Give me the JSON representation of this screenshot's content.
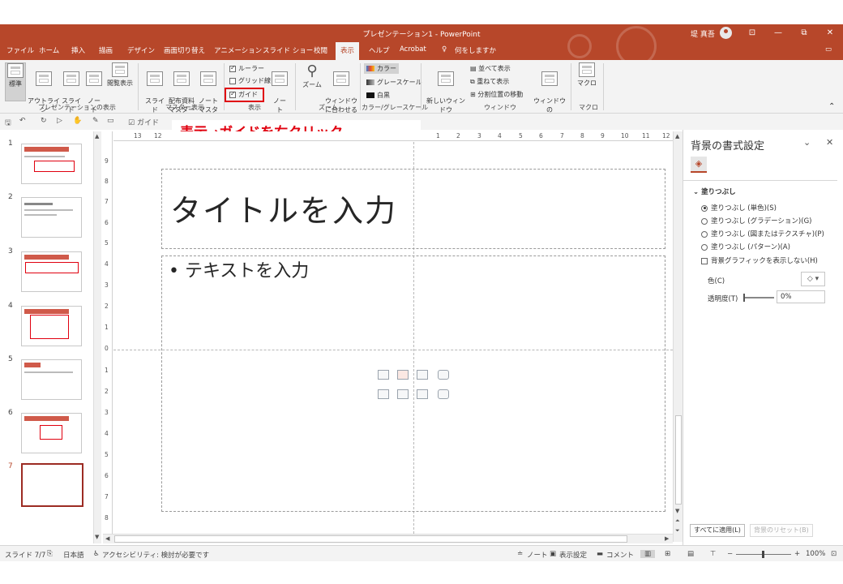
{
  "window": {
    "title": "プレゼンテーション1 - PowerPoint",
    "user": "堤 真吾",
    "controls": {
      "options": "⊡",
      "minimize": "—",
      "maximize": "⧉",
      "close": "✕"
    }
  },
  "tabs": [
    "ファイル",
    "ホーム",
    "挿入",
    "描画",
    "デザイン",
    "画面切り替え",
    "アニメーション",
    "スライド ショー",
    "校閲",
    "表示",
    "ヘルプ",
    "Acrobat"
  ],
  "active_tab": "表示",
  "tellme": "何をしますか",
  "ribbon": {
    "groups": {
      "presentation_views": "プレゼンテーションの表示",
      "master_views": "マスター表示",
      "show": "表示",
      "zoom": "ズーム",
      "color": "カラー/グレースケール",
      "window": "ウィンドウ",
      "macro": "マクロ"
    },
    "buttons": {
      "normal": "標準",
      "outline": "アウトライン\n表示",
      "sorter": "スライド\n一覧",
      "notes_page": "ノー\nト",
      "reading": "閲覧表示",
      "slide_master": "スライド\nマスター",
      "handout_master": "配布資料\nマスター",
      "notes_master": "ノート\nマスター",
      "notes": "ノー\nト",
      "zoom": "ズーム",
      "fit": "ウィンドウ\nに合わせる",
      "new_window": "新しいウィンドウ\nを開く",
      "switch_window": "ウィンドウの\n切り替え ⌄",
      "macro": "マクロ"
    },
    "checks": {
      "ruler": "ルーラー",
      "gridlines": "グリッド線",
      "guides": "ガイド"
    },
    "color_opts": {
      "color": "カラー",
      "grayscale": "グレースケール",
      "bw": "白黒"
    },
    "window_opts": {
      "arrange": "並べて表示",
      "cascade": "重ねて表示",
      "move_split": "分割位置の移動"
    }
  },
  "qat_guide": "ガイド",
  "callout": "表示→ガイドを右クリック",
  "ruler": {
    "h": [
      "13",
      "12",
      "1",
      "2",
      "3",
      "4",
      "5",
      "6",
      "7",
      "8",
      "9",
      "10",
      "11",
      "12"
    ],
    "v": [
      "9",
      "8",
      "7",
      "6",
      "5",
      "4",
      "3",
      "2",
      "1",
      "0",
      "1",
      "2",
      "3",
      "4",
      "5",
      "6",
      "7",
      "8"
    ]
  },
  "thumbnails": [
    "1",
    "2",
    "3",
    "4",
    "5",
    "6",
    "7"
  ],
  "selected_slide": "7",
  "slide": {
    "title_placeholder": "タイトルを入力",
    "body_placeholder": "• テキストを入力"
  },
  "pane": {
    "title": "背景の書式設定",
    "section": "塗りつぶし",
    "fill_options": [
      "塗りつぶし (単色)(S)",
      "塗りつぶし (グラデーション)(G)",
      "塗りつぶし (図またはテクスチャ)(P)",
      "塗りつぶし (パターン)(A)"
    ],
    "hide_bg_graphics": "背景グラフィックを表示しない(H)",
    "color_label": "色(C)",
    "transparency_label": "透明度(T)",
    "transparency_value": "0%",
    "apply_all": "すべてに適用(L)",
    "reset_bg": "背景のリセット(B)"
  },
  "status": {
    "slide": "スライド 7/7",
    "language": "日本語",
    "accessibility": "アクセシビリティ: 検討が必要です",
    "notes": "ノート",
    "display_settings": "表示設定",
    "comments": "コメント",
    "zoom_minus": "−",
    "zoom_plus": "+",
    "zoom": "100%"
  },
  "colors": {
    "accent": "#b7472a",
    "callout": "#e0000f"
  }
}
